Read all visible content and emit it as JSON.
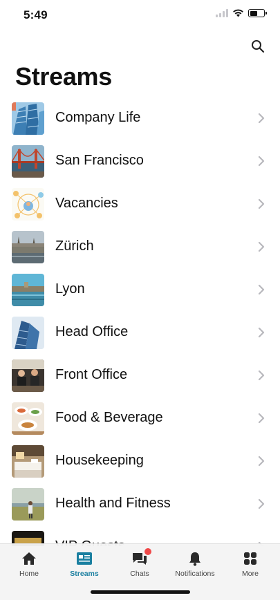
{
  "status_bar": {
    "time": "5:49"
  },
  "header": {
    "title": "Streams"
  },
  "streams": [
    {
      "label": "Company Life"
    },
    {
      "label": "San Francisco"
    },
    {
      "label": "Vacancies"
    },
    {
      "label": "Zürich"
    },
    {
      "label": "Lyon"
    },
    {
      "label": "Head Office"
    },
    {
      "label": "Front Office"
    },
    {
      "label": "Food & Beverage"
    },
    {
      "label": "Housekeeping"
    },
    {
      "label": "Health and Fitness"
    },
    {
      "label": "VIP Guests"
    }
  ],
  "tab_bar": {
    "tabs": [
      {
        "label": "Home",
        "icon": "home-icon"
      },
      {
        "label": "Streams",
        "icon": "streams-icon"
      },
      {
        "label": "Chats",
        "icon": "chat-icon"
      },
      {
        "label": "Notifications",
        "icon": "bell-icon"
      },
      {
        "label": "More",
        "icon": "grid-icon"
      }
    ],
    "active": "Streams",
    "accent_color": "#1a7fa0",
    "badge_color": "#f04848"
  }
}
